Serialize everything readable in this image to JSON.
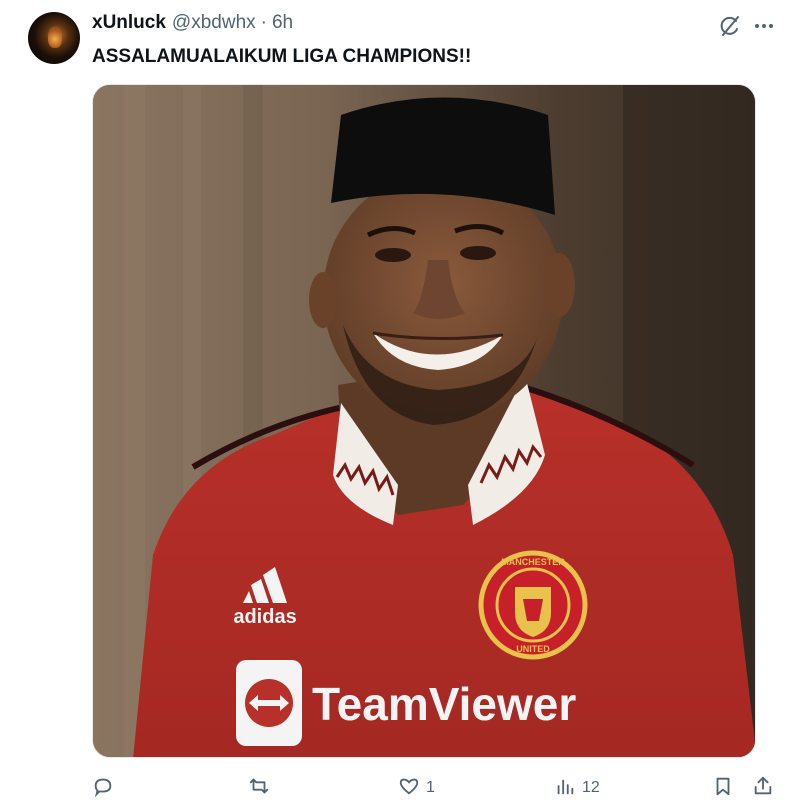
{
  "tweet": {
    "display_name": "xUnluck",
    "handle": "@xbdwhx",
    "separator": "·",
    "time": "6h",
    "text": "ASSALAMUALAIKUM LIGA CHAMPIONS!!"
  },
  "media": {
    "jersey_sponsor": "TeamViewer",
    "jersey_brand": "adidas",
    "badge_top": "MANCHESTER",
    "badge_bottom": "UNITED"
  },
  "actions": {
    "reply_count": "",
    "retweet_count": "",
    "like_count": "1",
    "views_count": "12"
  },
  "icons": {
    "avatar": "avatar-image",
    "grok": "grok-icon",
    "more": "more-icon",
    "reply": "reply-icon",
    "retweet": "retweet-icon",
    "like": "heart-icon",
    "views": "views-icon",
    "bookmark": "bookmark-icon",
    "share": "share-icon"
  },
  "colors": {
    "text_primary": "#0f1419",
    "text_secondary": "#536471",
    "jersey_red": "#b8302a"
  }
}
